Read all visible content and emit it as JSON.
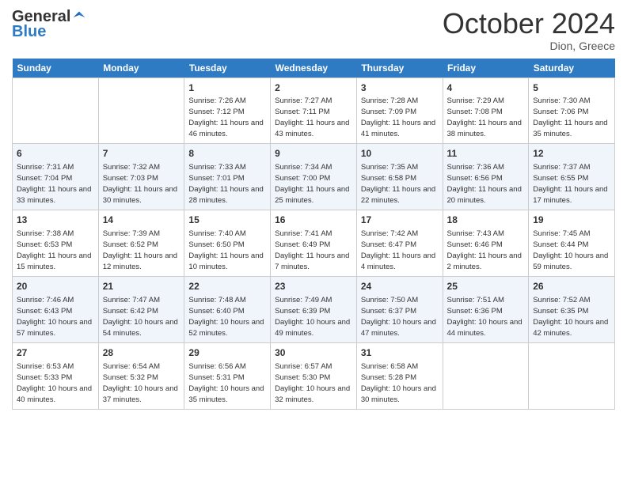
{
  "header": {
    "logo_general": "General",
    "logo_blue": "Blue",
    "month": "October 2024",
    "location": "Dion, Greece"
  },
  "days_of_week": [
    "Sunday",
    "Monday",
    "Tuesday",
    "Wednesday",
    "Thursday",
    "Friday",
    "Saturday"
  ],
  "weeks": [
    [
      {
        "day": "",
        "sunrise": "",
        "sunset": "",
        "daylight": ""
      },
      {
        "day": "",
        "sunrise": "",
        "sunset": "",
        "daylight": ""
      },
      {
        "day": "1",
        "sunrise": "Sunrise: 7:26 AM",
        "sunset": "Sunset: 7:12 PM",
        "daylight": "Daylight: 11 hours and 46 minutes."
      },
      {
        "day": "2",
        "sunrise": "Sunrise: 7:27 AM",
        "sunset": "Sunset: 7:11 PM",
        "daylight": "Daylight: 11 hours and 43 minutes."
      },
      {
        "day": "3",
        "sunrise": "Sunrise: 7:28 AM",
        "sunset": "Sunset: 7:09 PM",
        "daylight": "Daylight: 11 hours and 41 minutes."
      },
      {
        "day": "4",
        "sunrise": "Sunrise: 7:29 AM",
        "sunset": "Sunset: 7:08 PM",
        "daylight": "Daylight: 11 hours and 38 minutes."
      },
      {
        "day": "5",
        "sunrise": "Sunrise: 7:30 AM",
        "sunset": "Sunset: 7:06 PM",
        "daylight": "Daylight: 11 hours and 35 minutes."
      }
    ],
    [
      {
        "day": "6",
        "sunrise": "Sunrise: 7:31 AM",
        "sunset": "Sunset: 7:04 PM",
        "daylight": "Daylight: 11 hours and 33 minutes."
      },
      {
        "day": "7",
        "sunrise": "Sunrise: 7:32 AM",
        "sunset": "Sunset: 7:03 PM",
        "daylight": "Daylight: 11 hours and 30 minutes."
      },
      {
        "day": "8",
        "sunrise": "Sunrise: 7:33 AM",
        "sunset": "Sunset: 7:01 PM",
        "daylight": "Daylight: 11 hours and 28 minutes."
      },
      {
        "day": "9",
        "sunrise": "Sunrise: 7:34 AM",
        "sunset": "Sunset: 7:00 PM",
        "daylight": "Daylight: 11 hours and 25 minutes."
      },
      {
        "day": "10",
        "sunrise": "Sunrise: 7:35 AM",
        "sunset": "Sunset: 6:58 PM",
        "daylight": "Daylight: 11 hours and 22 minutes."
      },
      {
        "day": "11",
        "sunrise": "Sunrise: 7:36 AM",
        "sunset": "Sunset: 6:56 PM",
        "daylight": "Daylight: 11 hours and 20 minutes."
      },
      {
        "day": "12",
        "sunrise": "Sunrise: 7:37 AM",
        "sunset": "Sunset: 6:55 PM",
        "daylight": "Daylight: 11 hours and 17 minutes."
      }
    ],
    [
      {
        "day": "13",
        "sunrise": "Sunrise: 7:38 AM",
        "sunset": "Sunset: 6:53 PM",
        "daylight": "Daylight: 11 hours and 15 minutes."
      },
      {
        "day": "14",
        "sunrise": "Sunrise: 7:39 AM",
        "sunset": "Sunset: 6:52 PM",
        "daylight": "Daylight: 11 hours and 12 minutes."
      },
      {
        "day": "15",
        "sunrise": "Sunrise: 7:40 AM",
        "sunset": "Sunset: 6:50 PM",
        "daylight": "Daylight: 11 hours and 10 minutes."
      },
      {
        "day": "16",
        "sunrise": "Sunrise: 7:41 AM",
        "sunset": "Sunset: 6:49 PM",
        "daylight": "Daylight: 11 hours and 7 minutes."
      },
      {
        "day": "17",
        "sunrise": "Sunrise: 7:42 AM",
        "sunset": "Sunset: 6:47 PM",
        "daylight": "Daylight: 11 hours and 4 minutes."
      },
      {
        "day": "18",
        "sunrise": "Sunrise: 7:43 AM",
        "sunset": "Sunset: 6:46 PM",
        "daylight": "Daylight: 11 hours and 2 minutes."
      },
      {
        "day": "19",
        "sunrise": "Sunrise: 7:45 AM",
        "sunset": "Sunset: 6:44 PM",
        "daylight": "Daylight: 10 hours and 59 minutes."
      }
    ],
    [
      {
        "day": "20",
        "sunrise": "Sunrise: 7:46 AM",
        "sunset": "Sunset: 6:43 PM",
        "daylight": "Daylight: 10 hours and 57 minutes."
      },
      {
        "day": "21",
        "sunrise": "Sunrise: 7:47 AM",
        "sunset": "Sunset: 6:42 PM",
        "daylight": "Daylight: 10 hours and 54 minutes."
      },
      {
        "day": "22",
        "sunrise": "Sunrise: 7:48 AM",
        "sunset": "Sunset: 6:40 PM",
        "daylight": "Daylight: 10 hours and 52 minutes."
      },
      {
        "day": "23",
        "sunrise": "Sunrise: 7:49 AM",
        "sunset": "Sunset: 6:39 PM",
        "daylight": "Daylight: 10 hours and 49 minutes."
      },
      {
        "day": "24",
        "sunrise": "Sunrise: 7:50 AM",
        "sunset": "Sunset: 6:37 PM",
        "daylight": "Daylight: 10 hours and 47 minutes."
      },
      {
        "day": "25",
        "sunrise": "Sunrise: 7:51 AM",
        "sunset": "Sunset: 6:36 PM",
        "daylight": "Daylight: 10 hours and 44 minutes."
      },
      {
        "day": "26",
        "sunrise": "Sunrise: 7:52 AM",
        "sunset": "Sunset: 6:35 PM",
        "daylight": "Daylight: 10 hours and 42 minutes."
      }
    ],
    [
      {
        "day": "27",
        "sunrise": "Sunrise: 6:53 AM",
        "sunset": "Sunset: 5:33 PM",
        "daylight": "Daylight: 10 hours and 40 minutes."
      },
      {
        "day": "28",
        "sunrise": "Sunrise: 6:54 AM",
        "sunset": "Sunset: 5:32 PM",
        "daylight": "Daylight: 10 hours and 37 minutes."
      },
      {
        "day": "29",
        "sunrise": "Sunrise: 6:56 AM",
        "sunset": "Sunset: 5:31 PM",
        "daylight": "Daylight: 10 hours and 35 minutes."
      },
      {
        "day": "30",
        "sunrise": "Sunrise: 6:57 AM",
        "sunset": "Sunset: 5:30 PM",
        "daylight": "Daylight: 10 hours and 32 minutes."
      },
      {
        "day": "31",
        "sunrise": "Sunrise: 6:58 AM",
        "sunset": "Sunset: 5:28 PM",
        "daylight": "Daylight: 10 hours and 30 minutes."
      },
      {
        "day": "",
        "sunrise": "",
        "sunset": "",
        "daylight": ""
      },
      {
        "day": "",
        "sunrise": "",
        "sunset": "",
        "daylight": ""
      }
    ]
  ]
}
